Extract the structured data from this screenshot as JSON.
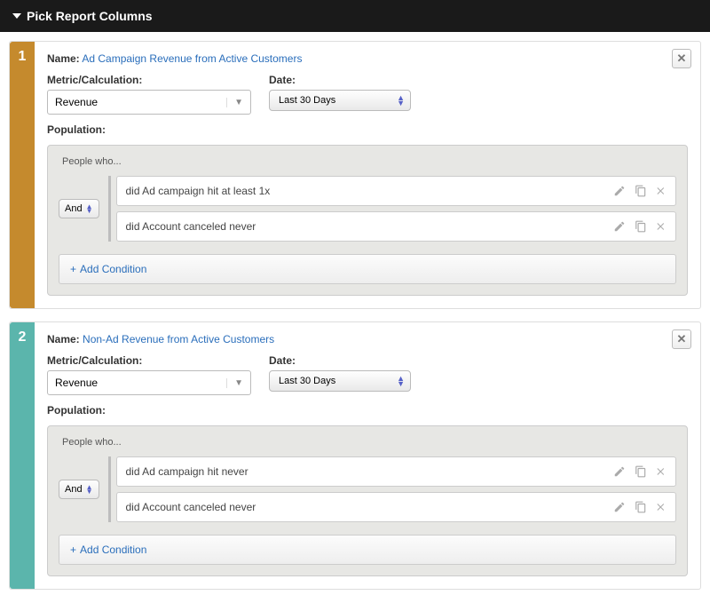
{
  "header": {
    "title": "Pick Report Columns"
  },
  "columns": [
    {
      "number": "1",
      "nameLabel": "Name:",
      "nameValue": "Ad Campaign Revenue from Active Customers",
      "metricLabel": "Metric/Calculation:",
      "metricValue": "Revenue",
      "dateLabel": "Date:",
      "dateValue": "Last 30 Days",
      "populationLabel": "Population:",
      "popHeader": "People who...",
      "andLabel": "And",
      "conditions": [
        {
          "text": "did Ad campaign hit at least 1x"
        },
        {
          "text": "did Account canceled never"
        }
      ],
      "addCondition": "Add Condition"
    },
    {
      "number": "2",
      "nameLabel": "Name:",
      "nameValue": "Non-Ad Revenue from Active Customers",
      "metricLabel": "Metric/Calculation:",
      "metricValue": "Revenue",
      "dateLabel": "Date:",
      "dateValue": "Last 30 Days",
      "populationLabel": "Population:",
      "popHeader": "People who...",
      "andLabel": "And",
      "conditions": [
        {
          "text": "did Ad campaign hit never"
        },
        {
          "text": "did Account canceled never"
        }
      ],
      "addCondition": "Add Condition"
    }
  ]
}
